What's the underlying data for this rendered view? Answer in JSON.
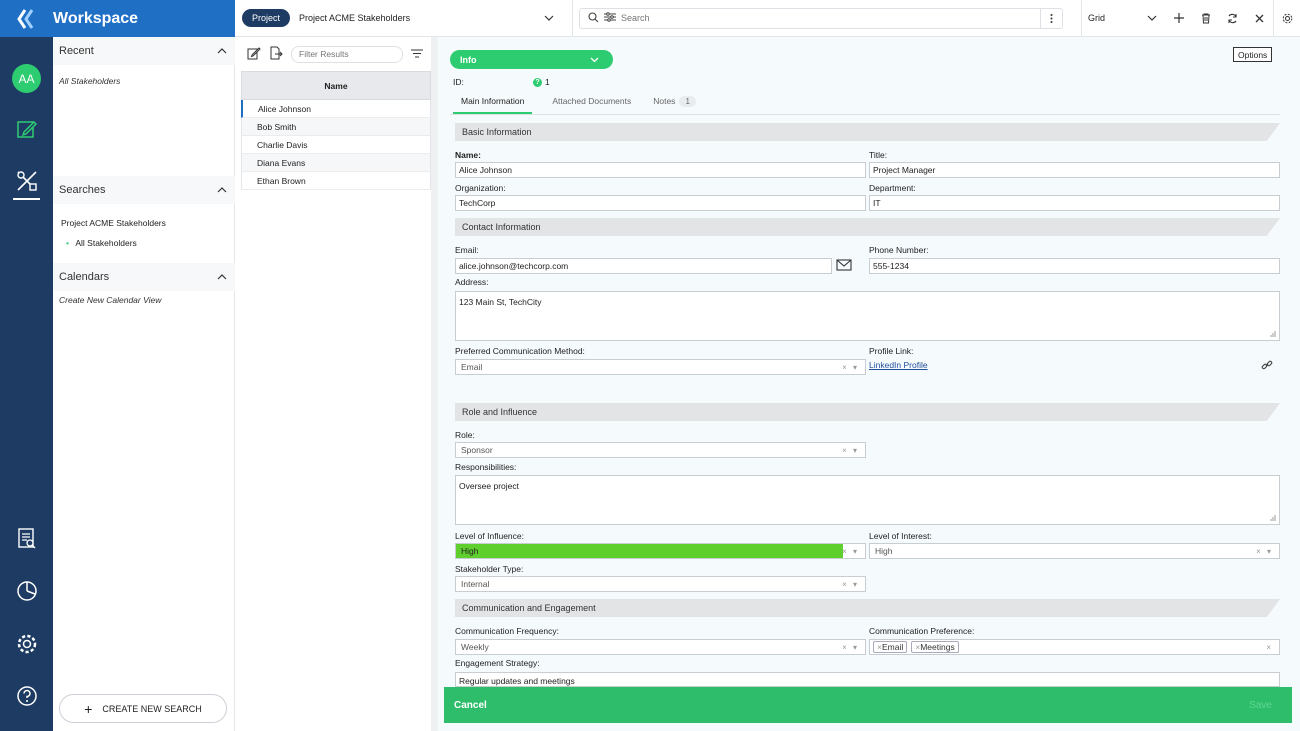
{
  "brand": {
    "title": "Workspace"
  },
  "project": {
    "pill": "Project",
    "name": "Project ACME Stakeholders"
  },
  "search": {
    "placeholder": "Search"
  },
  "view": {
    "mode": "Grid"
  },
  "rail": {
    "avatar": "AA"
  },
  "side": {
    "recent_title": "Recent",
    "recent_item": "All Stakeholders",
    "searches_title": "Searches",
    "search_project": "Project ACME Stakeholders",
    "search_item": "All Stakeholders",
    "calendars_title": "Calendars",
    "calendar_item": "Create New Calendar View",
    "create_search": "CREATE NEW SEARCH"
  },
  "list": {
    "filter_placeholder": "Filter Results",
    "header": "Name",
    "rows": [
      "Alice Johnson",
      "Bob Smith",
      "Charlie Davis",
      "Diana Evans",
      "Ethan Brown"
    ]
  },
  "detail": {
    "info": "Info",
    "options": "Options",
    "id_label": "ID:",
    "id_value": "1",
    "tabs": {
      "main": "Main Information",
      "docs": "Attached Documents",
      "notes": "Notes",
      "notes_count": "1"
    },
    "sections": {
      "basic": "Basic Information",
      "contact": "Contact Information",
      "role": "Role and Influence",
      "comm": "Communication and Engagement"
    },
    "fields": {
      "name_label": "Name:",
      "name": "Alice Johnson",
      "title_label": "Title:",
      "title": "Project Manager",
      "org_label": "Organization:",
      "org": "TechCorp",
      "dept_label": "Department:",
      "dept": "IT",
      "email_label": "Email:",
      "email": "alice.johnson@techcorp.com",
      "phone_label": "Phone Number:",
      "phone": "555-1234",
      "address_label": "Address:",
      "address": "123 Main St, TechCity",
      "pref_label": "Preferred Communication Method:",
      "pref": "Email",
      "profile_label": "Profile Link:",
      "profile": "LinkedIn Profile",
      "role_label": "Role:",
      "role": "Sponsor",
      "resp_label": "Responsibilities:",
      "resp": "Oversee project",
      "influence_label": "Level of Influence:",
      "influence": "High",
      "interest_label": "Level of Interest:",
      "interest": "High",
      "type_label": "Stakeholder Type:",
      "type": "Internal",
      "freq_label": "Communication Frequency:",
      "freq": "Weekly",
      "commpref_label": "Communication Preference:",
      "commpref_tags": [
        "Email",
        "Meetings"
      ],
      "strategy_label": "Engagement Strategy:",
      "strategy": "Regular updates and meetings"
    },
    "colors": {
      "influence_high": "#5fcf2e",
      "accent": "#2ecc71"
    }
  },
  "footer": {
    "cancel": "Cancel",
    "save": "Save"
  }
}
